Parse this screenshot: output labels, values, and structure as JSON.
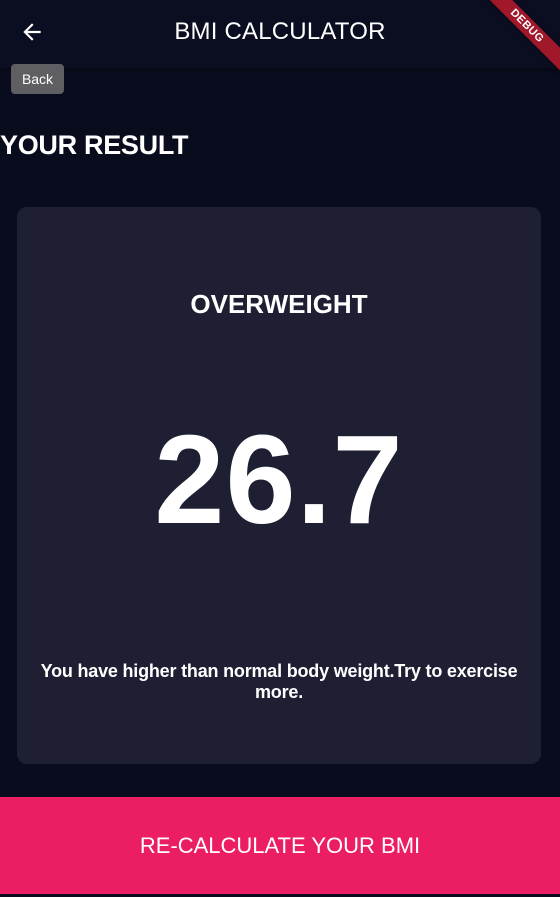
{
  "app_bar": {
    "title": "BMI CALCULATOR",
    "back_tooltip": "Back",
    "back_icon": "arrow-back-icon"
  },
  "debug_banner": "DEBUG",
  "page": {
    "section_title": "YOUR RESULT"
  },
  "result": {
    "label": "OVERWEIGHT",
    "bmi_value": "26.7",
    "message": "You have higher than normal body weight.Try to exercise more."
  },
  "bottom_button": {
    "label": "RE-CALCULATE YOUR BMI"
  },
  "colors": {
    "background": "#090c1d",
    "card": "#1e1f33",
    "accent": "#eb1e63",
    "debug_ribbon": "#a1182a"
  }
}
